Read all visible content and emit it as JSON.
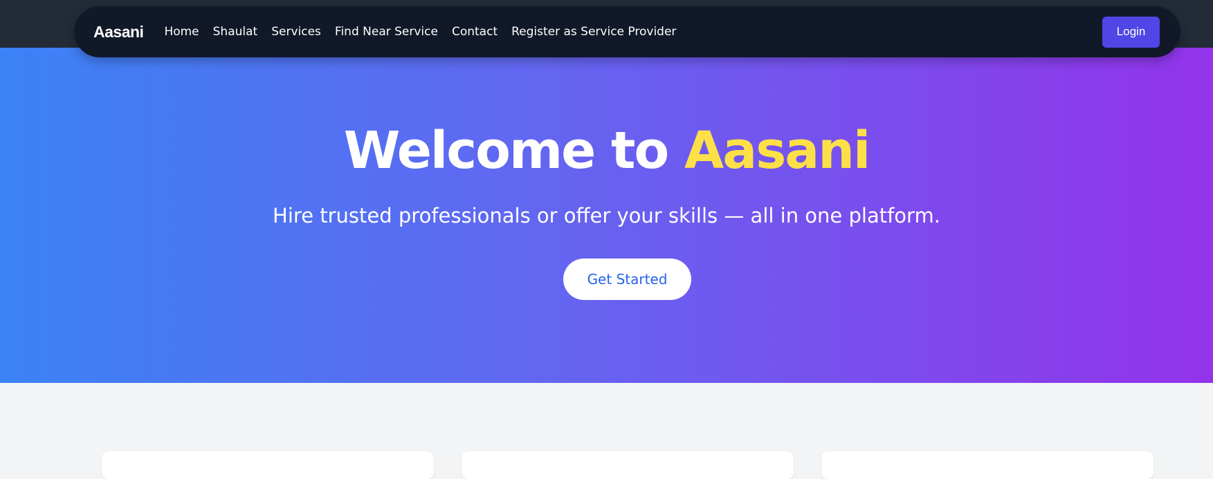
{
  "brand": "Aasani",
  "nav": {
    "links": [
      "Home",
      "Shaulat",
      "Services",
      "Find Near Service",
      "Contact",
      "Register as Service Provider"
    ],
    "login_label": "Login"
  },
  "hero": {
    "title_prefix": "Welcome to ",
    "title_accent": "Aasani",
    "subtitle": "Hire trusted professionals or offer your skills — all in one platform.",
    "cta_label": "Get Started"
  },
  "colors": {
    "navbar": "#111827",
    "login_button": "#4f46e5",
    "hero_gradient_start": "#3b82f6",
    "hero_gradient_end": "#9333ea",
    "accent_yellow": "#fde047",
    "cta_text": "#2563eb"
  }
}
